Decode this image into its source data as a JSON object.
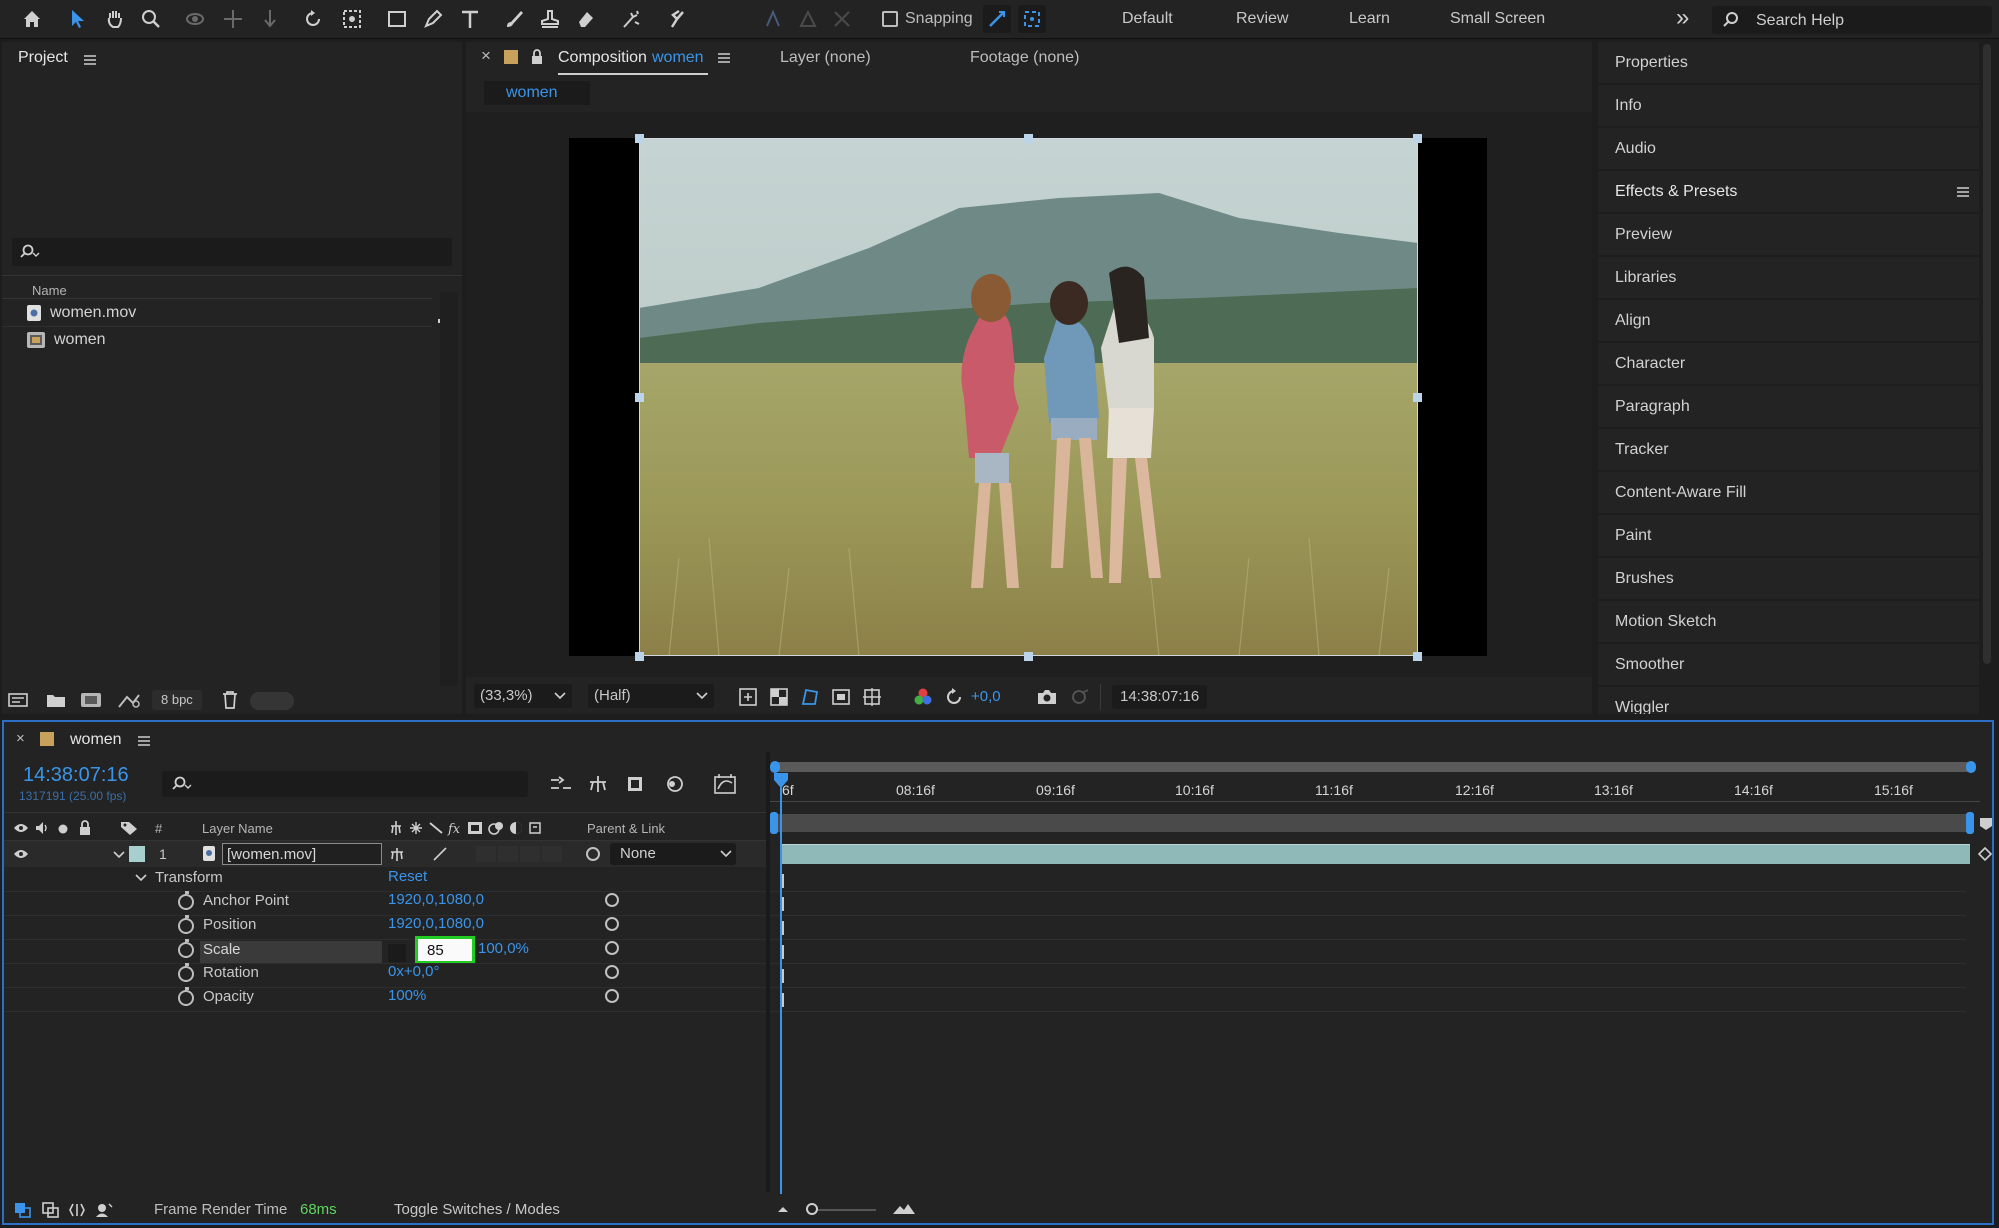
{
  "toolbar": {
    "snapping_label": "Snapping",
    "workspaces": [
      "Default",
      "Review",
      "Learn",
      "Small Screen"
    ],
    "search_placeholder": "Search Help",
    "overflow": "»"
  },
  "project": {
    "title": "Project",
    "column_name": "Name",
    "items": [
      {
        "name": "women.mov",
        "icon": "footage-icon"
      },
      {
        "name": "women",
        "icon": "composition-icon"
      }
    ],
    "bpc": "8 bpc"
  },
  "composition": {
    "close": "×",
    "tab_prefix": "Composition",
    "tab_name": "women",
    "layer_tab": "Layer (none)",
    "footage_tab": "Footage (none)",
    "breadcrumb": "women",
    "zoom": "(33,3%)",
    "resolution": "(Half)",
    "exposure": "+0,0",
    "timecode": "14:38:07:16"
  },
  "right_panel": {
    "items": [
      "Properties",
      "Info",
      "Audio",
      "Effects & Presets",
      "Preview",
      "Libraries",
      "Align",
      "Character",
      "Paragraph",
      "Tracker",
      "Content-Aware Fill",
      "Paint",
      "Brushes",
      "Motion Sketch",
      "Smoother",
      "Wiggler"
    ]
  },
  "timeline": {
    "close": "×",
    "title": "women",
    "timecode": "14:38:07:16",
    "frame_info": "1317191 (25.00 fps)",
    "columns": {
      "number": "#",
      "layer_name": "Layer Name",
      "parent": "Parent & Link"
    },
    "layer": {
      "number": "1",
      "name": "[women.mov]",
      "parent": "None"
    },
    "transform": {
      "label": "Transform",
      "reset": "Reset"
    },
    "properties": [
      {
        "name": "Anchor Point",
        "value": "1920,0,1080,0"
      },
      {
        "name": "Position",
        "value": "1920,0,1080,0"
      },
      {
        "name": "Scale",
        "value_editing": "85",
        "value_rest": "100,0%"
      },
      {
        "name": "Rotation",
        "value": "0x+0,0°"
      },
      {
        "name": "Opacity",
        "value": "100%"
      }
    ],
    "ruler": [
      "08:16f",
      "09:16f",
      "10:16f",
      "11:16f",
      "12:16f",
      "13:16f",
      "14:16f",
      "15:16f"
    ],
    "ruler_start": "6f",
    "footer": {
      "render_label": "Frame Render Time",
      "render_value": "68ms",
      "toggle": "Toggle Switches / Modes"
    }
  },
  "colors": {
    "accent_blue": "#3a95ea",
    "edit_highlight": "#22cc22",
    "layer_bar": "#8fb8b8"
  }
}
